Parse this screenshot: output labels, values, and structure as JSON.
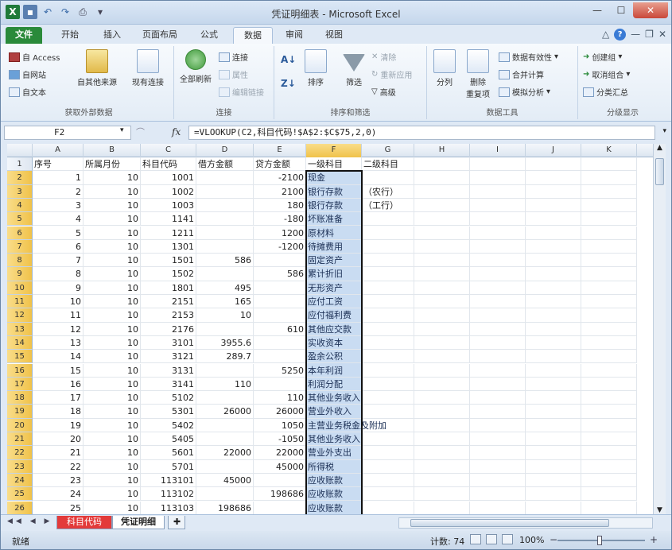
{
  "window": {
    "title": "凭证明细表 - Microsoft Excel",
    "qat_icons": [
      "excel-logo",
      "save-icon",
      "undo-icon",
      "redo-icon",
      "print-preview-icon"
    ],
    "controls": [
      "minimize",
      "maximize",
      "close"
    ]
  },
  "tabs": [
    {
      "label": "文件",
      "key": "file"
    },
    {
      "label": "开始",
      "key": "home"
    },
    {
      "label": "插入",
      "key": "insert"
    },
    {
      "label": "页面布局",
      "key": "layout"
    },
    {
      "label": "公式",
      "key": "formulas"
    },
    {
      "label": "数据",
      "key": "data",
      "active": true
    },
    {
      "label": "审阅",
      "key": "review"
    },
    {
      "label": "视图",
      "key": "view"
    }
  ],
  "ribbon": {
    "get_external": {
      "label": "获取外部数据",
      "access": "自 Access",
      "web": "自网站",
      "text": "自文本",
      "other": "自其他来源",
      "existing": "现有连接"
    },
    "connections": {
      "label": "连接",
      "refresh_all": "全部刷新",
      "connect": "连接",
      "properties": "属性",
      "edit_links": "编辑链接"
    },
    "sort_filter": {
      "label": "排序和筛选",
      "sort": "排序",
      "filter": "筛选",
      "clear": "清除",
      "reapply": "重新应用",
      "advanced": "高级"
    },
    "data_tools": {
      "label": "数据工具",
      "split": "分列",
      "remove_dup": "删除",
      "remove_dup2": "重复项",
      "validation": "数据有效性",
      "consolidate": "合并计算",
      "whatif": "模拟分析"
    },
    "outline": {
      "label": "分级显示",
      "group": "创建组",
      "ungroup": "取消组合",
      "subtotal": "分类汇总"
    }
  },
  "formula_bar": {
    "name_box": "F2",
    "formula": "=VLOOKUP(C2,科目代码!$A$2:$C$75,2,0)"
  },
  "columns": [
    "A",
    "B",
    "C",
    "D",
    "E",
    "F",
    "G",
    "H",
    "I",
    "J",
    "K"
  ],
  "header_row": {
    "A": "序号",
    "B": "所属月份",
    "C": "科目代码",
    "D": "借方金额",
    "E": "贷方金额",
    "F": "一级科目",
    "G": "二级科目"
  },
  "rows": [
    {
      "n": "2",
      "A": "1",
      "B": "10",
      "C": "1001",
      "D": "",
      "E": "-2100",
      "F": "现金",
      "G": ""
    },
    {
      "n": "3",
      "A": "2",
      "B": "10",
      "C": "1002",
      "D": "",
      "E": "2100",
      "F": "银行存款",
      "G": "（农行）"
    },
    {
      "n": "4",
      "A": "3",
      "B": "10",
      "C": "1003",
      "D": "",
      "E": "180",
      "F": "银行存款",
      "G": "（工行）"
    },
    {
      "n": "5",
      "A": "4",
      "B": "10",
      "C": "1141",
      "D": "",
      "E": "-180",
      "F": "坏账准备",
      "G": ""
    },
    {
      "n": "6",
      "A": "5",
      "B": "10",
      "C": "1211",
      "D": "",
      "E": "1200",
      "F": "原材料",
      "G": ""
    },
    {
      "n": "7",
      "A": "6",
      "B": "10",
      "C": "1301",
      "D": "",
      "E": "-1200",
      "F": "待摊费用",
      "G": ""
    },
    {
      "n": "8",
      "A": "7",
      "B": "10",
      "C": "1501",
      "D": "586",
      "E": "",
      "F": "固定资产",
      "G": ""
    },
    {
      "n": "9",
      "A": "8",
      "B": "10",
      "C": "1502",
      "D": "",
      "E": "586",
      "F": "累计折旧",
      "G": ""
    },
    {
      "n": "10",
      "A": "9",
      "B": "10",
      "C": "1801",
      "D": "495",
      "E": "",
      "F": "无形资产",
      "G": ""
    },
    {
      "n": "11",
      "A": "10",
      "B": "10",
      "C": "2151",
      "D": "165",
      "E": "",
      "F": "应付工资",
      "G": ""
    },
    {
      "n": "12",
      "A": "11",
      "B": "10",
      "C": "2153",
      "D": "10",
      "E": "",
      "F": "应付福利费",
      "G": ""
    },
    {
      "n": "13",
      "A": "12",
      "B": "10",
      "C": "2176",
      "D": "",
      "E": "610",
      "F": "其他应交款",
      "G": ""
    },
    {
      "n": "14",
      "A": "13",
      "B": "10",
      "C": "3101",
      "D": "3955.6",
      "E": "",
      "F": "实收资本",
      "G": ""
    },
    {
      "n": "15",
      "A": "14",
      "B": "10",
      "C": "3121",
      "D": "289.7",
      "E": "",
      "F": "盈余公积",
      "G": ""
    },
    {
      "n": "16",
      "A": "15",
      "B": "10",
      "C": "3131",
      "D": "",
      "E": "5250",
      "F": "本年利润",
      "G": ""
    },
    {
      "n": "17",
      "A": "16",
      "B": "10",
      "C": "3141",
      "D": "110",
      "E": "",
      "F": "利润分配",
      "G": ""
    },
    {
      "n": "18",
      "A": "17",
      "B": "10",
      "C": "5102",
      "D": "",
      "E": "110",
      "F": "其他业务收入",
      "G": ""
    },
    {
      "n": "19",
      "A": "18",
      "B": "10",
      "C": "5301",
      "D": "26000",
      "E": "26000",
      "F": "营业外收入",
      "G": ""
    },
    {
      "n": "20",
      "A": "19",
      "B": "10",
      "C": "5402",
      "D": "",
      "E": "1050",
      "F": "主营业务税金及附加",
      "G": ""
    },
    {
      "n": "21",
      "A": "20",
      "B": "10",
      "C": "5405",
      "D": "",
      "E": "-1050",
      "F": "其他业务收入",
      "G": ""
    },
    {
      "n": "22",
      "A": "21",
      "B": "10",
      "C": "5601",
      "D": "22000",
      "E": "22000",
      "F": "营业外支出",
      "G": ""
    },
    {
      "n": "23",
      "A": "22",
      "B": "10",
      "C": "5701",
      "D": "",
      "E": "45000",
      "F": "所得税",
      "G": ""
    },
    {
      "n": "24",
      "A": "23",
      "B": "10",
      "C": "113101",
      "D": "45000",
      "E": "",
      "F": "应收账款",
      "G": ""
    },
    {
      "n": "25",
      "A": "24",
      "B": "10",
      "C": "113102",
      "D": "",
      "E": "198686",
      "F": "应收账款",
      "G": ""
    },
    {
      "n": "26",
      "A": "25",
      "B": "10",
      "C": "113103",
      "D": "198686",
      "E": "",
      "F": "应收账款",
      "G": ""
    }
  ],
  "sheets": [
    {
      "label": "科目代码",
      "color": "#e33a3a"
    },
    {
      "label": "凭证明细",
      "active": true
    }
  ],
  "status": {
    "ready": "就绪",
    "count": "计数: 74",
    "zoom": "100%"
  }
}
